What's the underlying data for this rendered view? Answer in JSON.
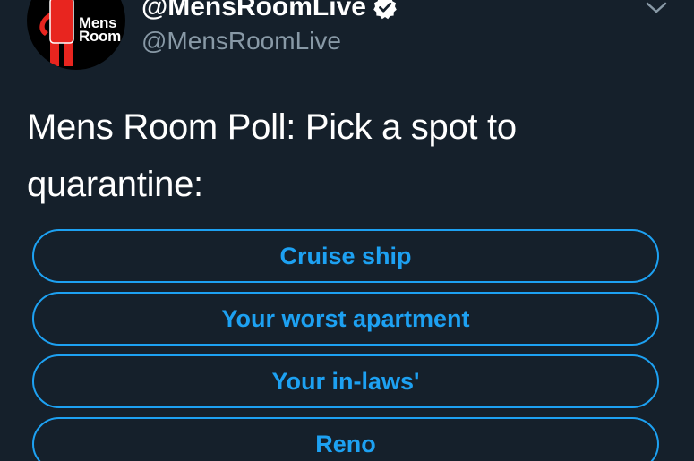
{
  "header": {
    "display_name": "@MensRoomLive",
    "handle": "@MensRoomLive",
    "avatar": {
      "line1": "Mens",
      "line2": "Room",
      "logo_color": "#e8251f"
    },
    "verified_icon": "verified-badge-icon",
    "menu_icon": "chevron-down-icon"
  },
  "tweet": {
    "text": "Mens Room Poll: Pick a spot to quarantine:"
  },
  "poll": {
    "options": [
      {
        "label": "Cruise ship"
      },
      {
        "label": "Your worst apartment"
      },
      {
        "label": "Your in-laws'"
      },
      {
        "label": "Reno"
      }
    ]
  },
  "colors": {
    "background": "#15202b",
    "accent": "#1da1f2",
    "secondary_text": "#8899a6",
    "primary_text": "#ffffff"
  }
}
